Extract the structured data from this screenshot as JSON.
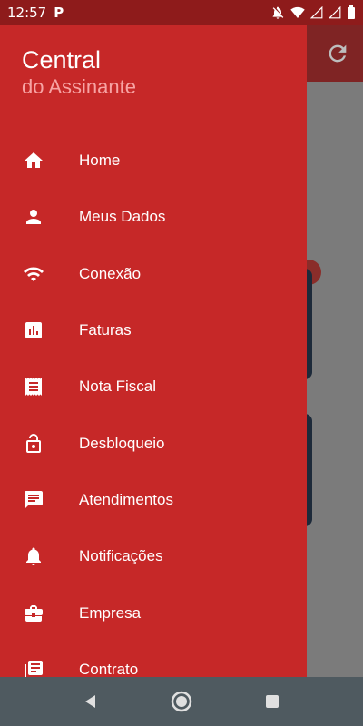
{
  "status_bar": {
    "time": "12:57",
    "app_indicator": "P",
    "icons": [
      "notifications-off-icon",
      "wifi-icon",
      "signal-icon",
      "signal-icon",
      "battery-icon"
    ]
  },
  "drawer": {
    "title": "Central",
    "subtitle": "do Assinante",
    "items": [
      {
        "label": "Home",
        "icon": "home-icon"
      },
      {
        "label": "Meus Dados",
        "icon": "person-icon"
      },
      {
        "label": "Conexão",
        "icon": "wifi-icon"
      },
      {
        "label": "Faturas",
        "icon": "chart-icon"
      },
      {
        "label": "Nota Fiscal",
        "icon": "receipt-icon"
      },
      {
        "label": "Desbloqueio",
        "icon": "lock-open-icon"
      },
      {
        "label": "Atendimentos",
        "icon": "chat-icon"
      },
      {
        "label": "Notificações",
        "icon": "bell-icon"
      },
      {
        "label": "Empresa",
        "icon": "briefcase-icon"
      },
      {
        "label": "Contrato",
        "icon": "contract-icon"
      }
    ]
  },
  "background_app": {
    "refresh_icon": "refresh-icon"
  },
  "nav_bar": {
    "buttons": [
      "back-icon",
      "home-circle-icon",
      "recents-icon"
    ]
  },
  "colors": {
    "drawer": "#c62828",
    "subtitle": "#f7a3a3",
    "status_bar": "#8e1b1b",
    "nav_bar": "#4f5a60"
  }
}
